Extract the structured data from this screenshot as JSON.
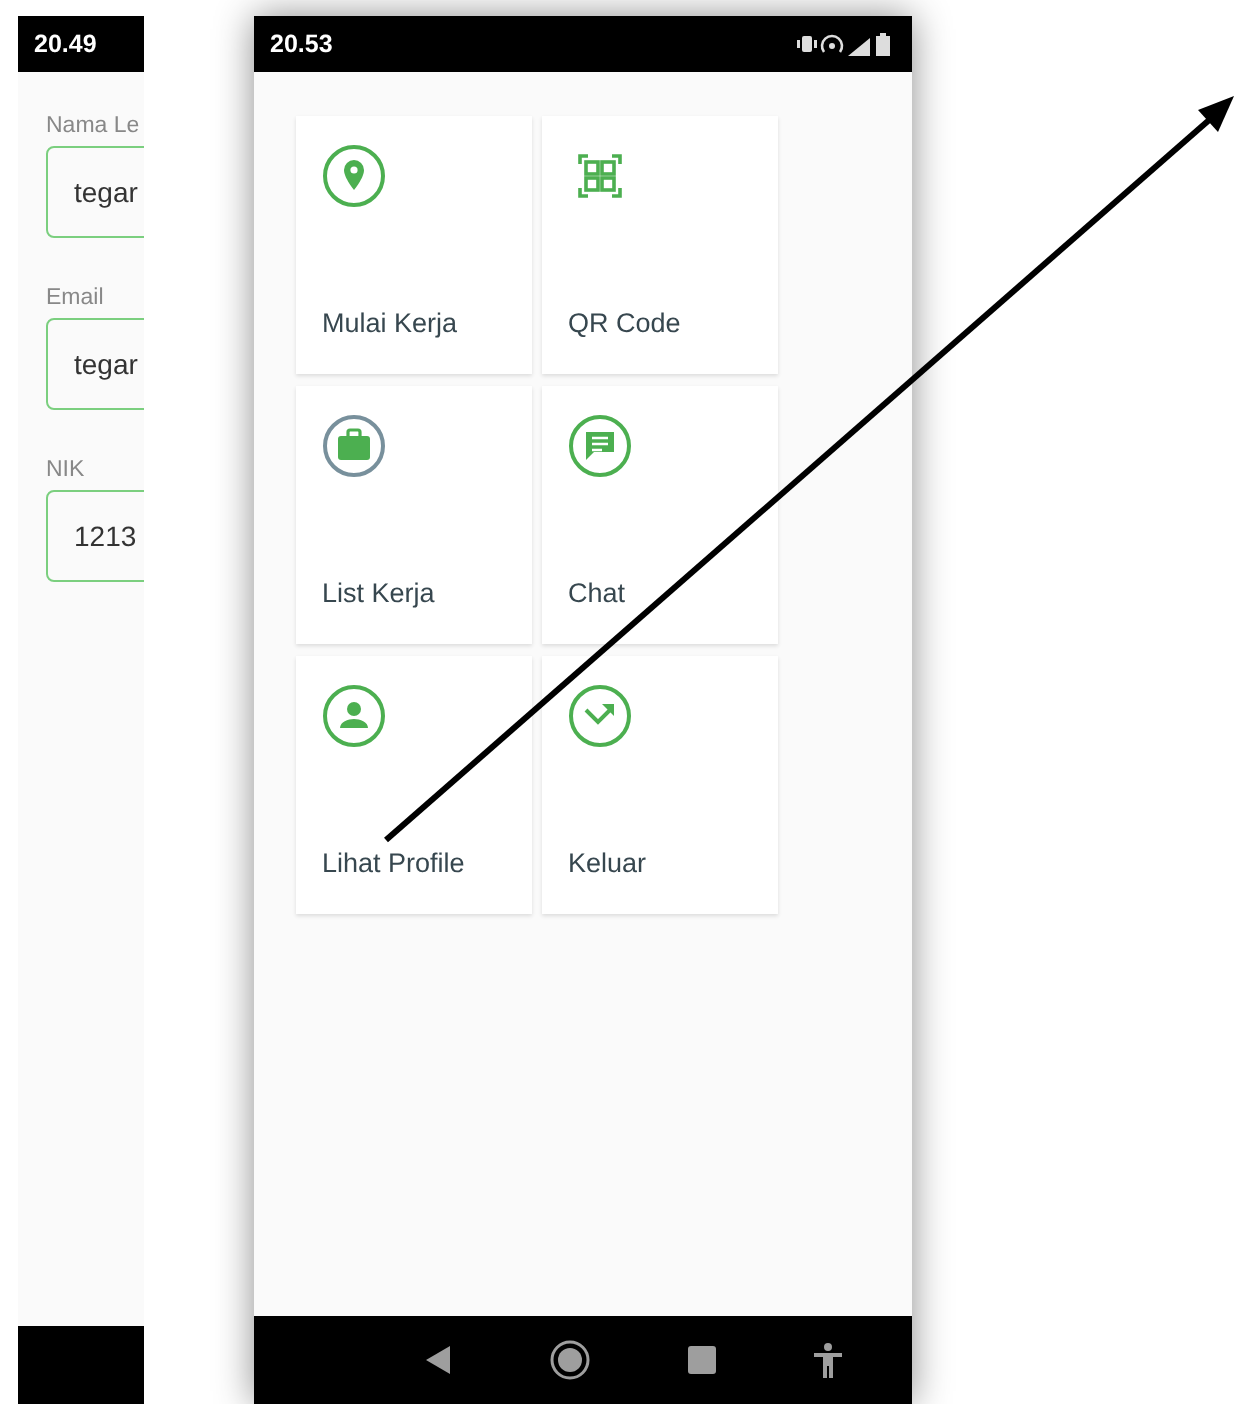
{
  "left_screen": {
    "status_bar": {
      "time": "20.49"
    },
    "fields": [
      {
        "label": "Nama Le",
        "value": "tegar"
      },
      {
        "label": "Email",
        "value": "tegar"
      },
      {
        "label": "NIK",
        "value": "1213"
      }
    ]
  },
  "main_screen": {
    "status_bar": {
      "time": "20.53"
    },
    "menu": [
      {
        "label": "Mulai Kerja"
      },
      {
        "label": "QR Code"
      },
      {
        "label": "List Kerja"
      },
      {
        "label": "Chat"
      },
      {
        "label": "Lihat Profile"
      },
      {
        "label": "Keluar"
      }
    ]
  }
}
